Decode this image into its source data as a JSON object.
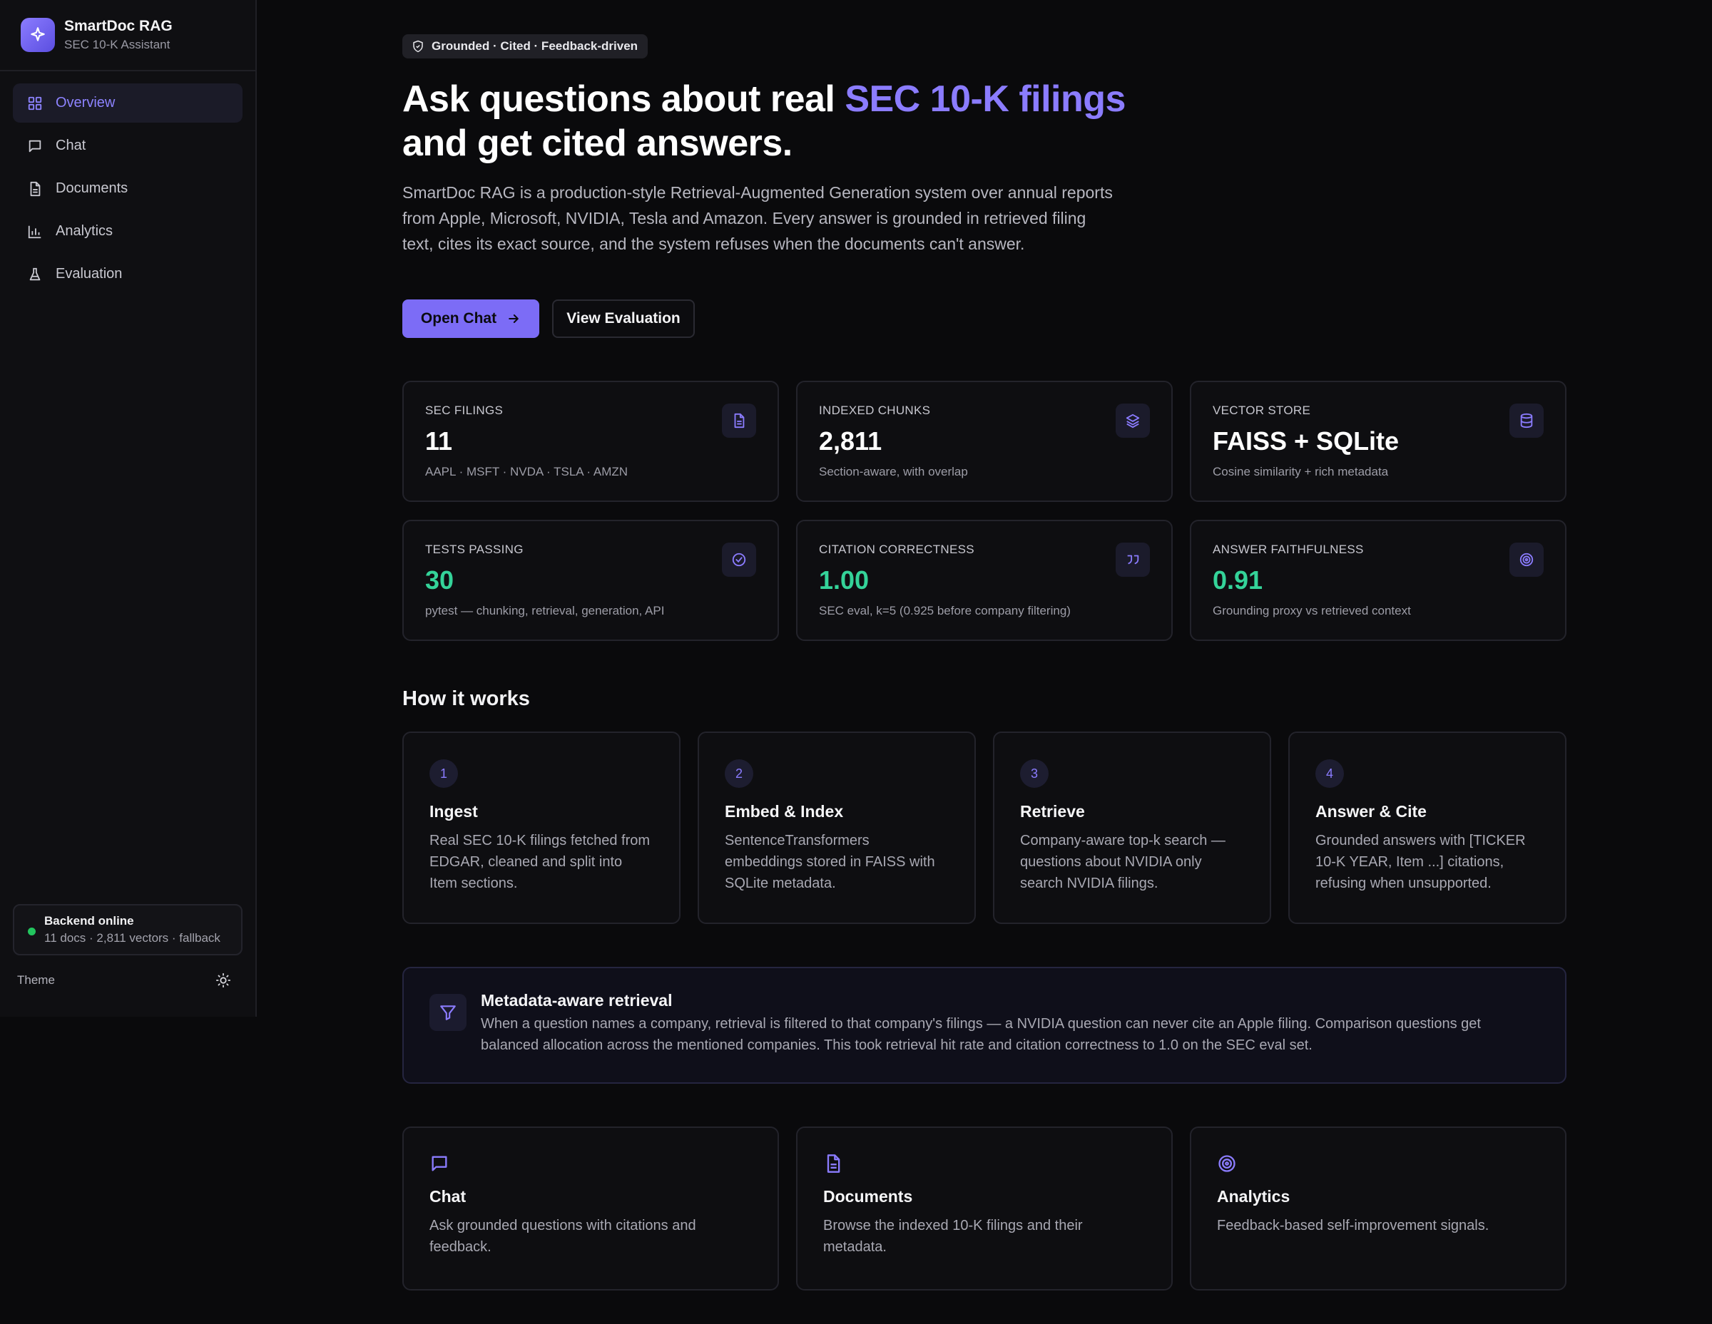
{
  "brand": {
    "title": "SmartDoc RAG",
    "subtitle": "SEC 10-K Assistant"
  },
  "nav": [
    {
      "label": "Overview",
      "icon": "grid-icon",
      "active": true
    },
    {
      "label": "Chat",
      "icon": "message-icon"
    },
    {
      "label": "Documents",
      "icon": "document-icon"
    },
    {
      "label": "Analytics",
      "icon": "bar-chart-icon"
    },
    {
      "label": "Evaluation",
      "icon": "flask-icon"
    }
  ],
  "status": {
    "title": "Backend online",
    "detail": "11 docs · 2,811 vectors · fallback",
    "color": "#22c55e"
  },
  "theme": {
    "label": "Theme",
    "icon": "sun-icon"
  },
  "hero": {
    "badge": "Grounded · Cited · Feedback-driven",
    "title_part1": "Ask questions about real ",
    "title_accent": "SEC 10-K filings",
    "title_part2": "and get cited answers.",
    "description": "SmartDoc RAG is a production-style Retrieval-Augmented Generation system over annual reports from Apple, Microsoft, NVIDIA, Tesla and Amazon. Every answer is grounded in retrieved filing text, cites its exact source, and the system refuses when the documents can't answer.",
    "primary_button": "Open Chat",
    "secondary_button": "View Evaluation"
  },
  "stats": [
    {
      "label": "SEC FILINGS",
      "value": "11",
      "sub": "AAPL · MSFT · NVDA · TSLA · AMZN",
      "icon": "document-icon"
    },
    {
      "label": "INDEXED CHUNKS",
      "value": "2,811",
      "sub": "Section-aware, with overlap",
      "icon": "layers-icon"
    },
    {
      "label": "VECTOR STORE",
      "value": "FAISS + SQLite",
      "sub": "Cosine similarity + rich metadata",
      "icon": "database-icon"
    },
    {
      "label": "TESTS PASSING",
      "value": "30",
      "sub": "pytest — chunking, retrieval, generation, API",
      "icon": "check-circle-icon"
    },
    {
      "label": "CITATION CORRECTNESS",
      "value": "1.00",
      "sub": "SEC eval, k=5 (0.925 before company filtering)",
      "icon": "quote-icon"
    },
    {
      "label": "ANSWER FAITHFULNESS",
      "value": "0.91",
      "sub": "Grounding proxy vs retrieved context",
      "icon": "target-icon"
    }
  ],
  "how_it_works": {
    "title": "How it works",
    "steps": [
      {
        "num": "1",
        "title": "Ingest",
        "desc": "Real SEC 10-K filings fetched from EDGAR, cleaned and split into Item sections."
      },
      {
        "num": "2",
        "title": "Embed & Index",
        "desc": "SentenceTransformers embeddings stored in FAISS with SQLite metadata."
      },
      {
        "num": "3",
        "title": "Retrieve",
        "desc": "Company-aware top-k search — questions about NVIDIA only search NVIDIA filings."
      },
      {
        "num": "4",
        "title": "Answer & Cite",
        "desc": "Grounded answers with [TICKER 10-K YEAR, Item ...] citations, refusing when unsupported."
      }
    ]
  },
  "metadata_card": {
    "title": "Metadata-aware retrieval",
    "desc": "When a question names a company, retrieval is filtered to that company's filings — a NVIDIA question can never cite an Apple filing. Comparison questions get balanced allocation across the mentioned companies. This took retrieval hit rate and citation correctness to 1.0 on the SEC eval set.",
    "icon": "filter-icon"
  },
  "links": [
    {
      "title": "Chat",
      "desc": "Ask grounded questions with citations and feedback.",
      "icon": "message-icon"
    },
    {
      "title": "Documents",
      "desc": "Browse the indexed 10-K filings and their metadata.",
      "icon": "document-icon"
    },
    {
      "title": "Analytics",
      "desc": "Feedback-based self-improvement signals.",
      "icon": "target-icon"
    }
  ],
  "colors": {
    "accent": "#8b7cff",
    "success": "#34d399",
    "background": "#0a0a0c"
  }
}
